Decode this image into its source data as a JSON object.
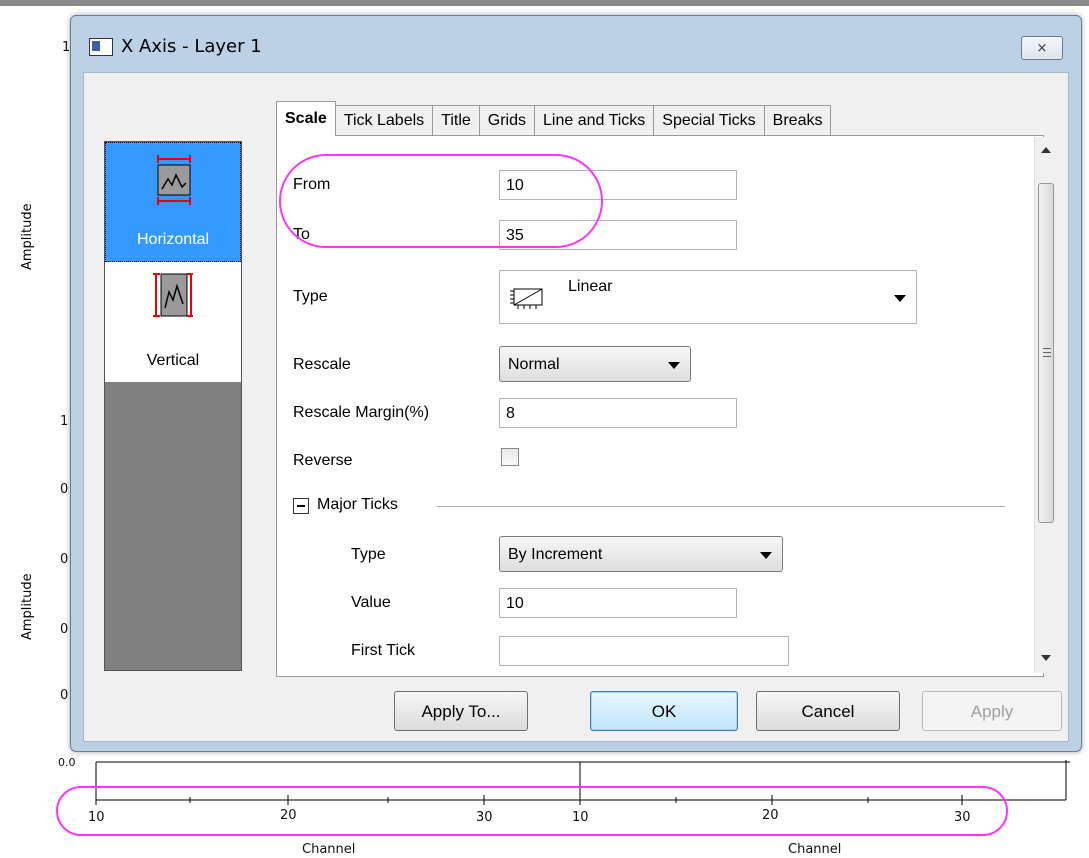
{
  "background": {
    "ylabel_top": "Amplitude",
    "ylabel_bottom": "Amplitude",
    "left_ticks": [
      "1",
      "1",
      "0",
      "0",
      "0",
      "0",
      "0.0"
    ],
    "xticks_left": [
      "10",
      "20",
      "30"
    ],
    "xticks_right": [
      "10",
      "20",
      "30"
    ],
    "xlabel_left": "Channel",
    "xlabel_right": "Channel"
  },
  "dialog": {
    "title": "X Axis - Layer 1",
    "close_symbol": "⨯"
  },
  "left_panel": {
    "items": [
      {
        "label": "Horizontal",
        "icon": "horizontal-axis-icon",
        "selected": true
      },
      {
        "label": "Vertical",
        "icon": "vertical-axis-icon",
        "selected": false
      }
    ]
  },
  "tabs": [
    "Scale",
    "Tick Labels",
    "Title",
    "Grids",
    "Line and Ticks",
    "Special Ticks",
    "Breaks"
  ],
  "scale": {
    "from_label": "From",
    "from_value": "10",
    "to_label": "To",
    "to_value": "35",
    "type_label": "Type",
    "type_value": "Linear",
    "type_icon": "linear-scale-icon",
    "rescale_label": "Rescale",
    "rescale_value": "Normal",
    "margin_label": "Rescale Margin(%)",
    "margin_value": "8",
    "reverse_label": "Reverse",
    "reverse_checked": false,
    "major_ticks": {
      "section_label": "Major Ticks",
      "type_label": "Type",
      "type_value": "By Increment",
      "value_label": "Value",
      "value_value": "10",
      "first_tick_label": "First Tick",
      "first_tick_value": ""
    }
  },
  "buttons": {
    "apply_to": "Apply To...",
    "ok": "OK",
    "cancel": "Cancel",
    "apply": "Apply"
  },
  "colors": {
    "highlight": "#ff33ff",
    "selection": "#3399ff"
  }
}
